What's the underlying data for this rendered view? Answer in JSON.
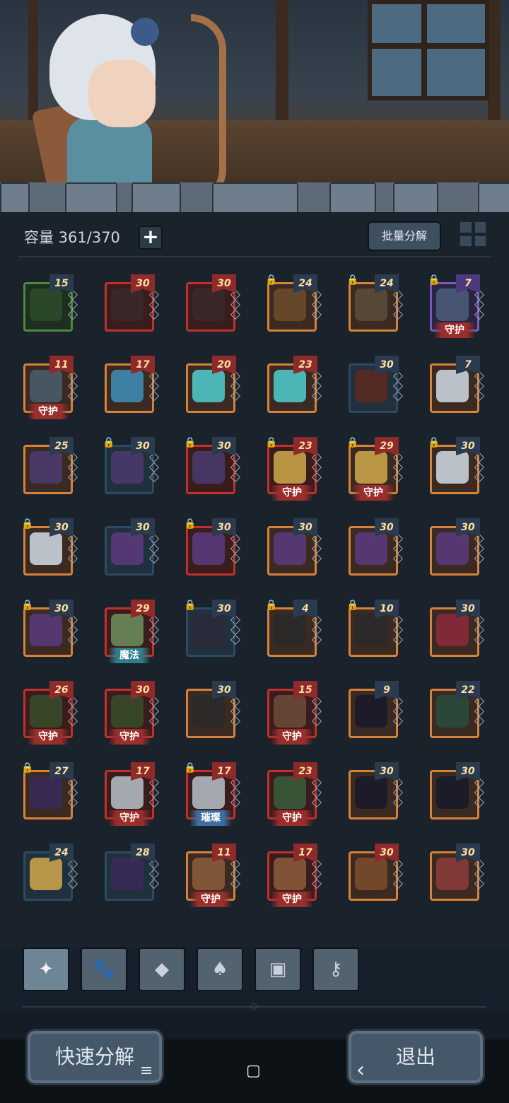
{
  "header": {
    "capacity_label": "容量 361/370",
    "plus_label": "+",
    "batch_label": "批量分解"
  },
  "items": [
    {
      "level": "15",
      "frame": "green",
      "lock": false,
      "tag": "",
      "tagType": "",
      "levelColor": "blue",
      "icon": "ring-icon",
      "color": "#2c4a2a"
    },
    {
      "level": "30",
      "frame": "red",
      "lock": false,
      "tag": "",
      "tagType": "",
      "levelColor": "red",
      "icon": "gauntlet-icon",
      "color": "#3a2a2a"
    },
    {
      "level": "30",
      "frame": "red",
      "lock": false,
      "tag": "",
      "tagType": "",
      "levelColor": "red",
      "icon": "gauntlet-icon",
      "color": "#3a2a2a"
    },
    {
      "level": "24",
      "frame": "orange",
      "lock": true,
      "tag": "",
      "tagType": "",
      "levelColor": "blue",
      "icon": "trident-icon",
      "color": "#6a4a2a"
    },
    {
      "level": "24",
      "frame": "orange",
      "lock": true,
      "tag": "",
      "tagType": "",
      "levelColor": "blue",
      "icon": "bow-icon",
      "color": "#5a4a3a"
    },
    {
      "level": "7",
      "frame": "purple",
      "lock": true,
      "tag": "守护",
      "tagType": "guard",
      "levelColor": "purple",
      "icon": "staff-icon",
      "color": "#4a5a7a"
    },
    {
      "level": "11",
      "frame": "orange",
      "lock": false,
      "tag": "守护",
      "tagType": "guard",
      "levelColor": "red",
      "icon": "staff-icon",
      "color": "#4a5a6a"
    },
    {
      "level": "17",
      "frame": "orange",
      "lock": false,
      "tag": "",
      "tagType": "",
      "levelColor": "red",
      "icon": "boomerang-icon",
      "color": "#3f8ab0"
    },
    {
      "level": "20",
      "frame": "orange",
      "lock": false,
      "tag": "",
      "tagType": "",
      "levelColor": "red",
      "icon": "crystal-sword-icon",
      "color": "#4ec5c5"
    },
    {
      "level": "23",
      "frame": "orange",
      "lock": false,
      "tag": "",
      "tagType": "",
      "levelColor": "red",
      "icon": "crystal-sword-icon",
      "color": "#4ec5c5"
    },
    {
      "level": "30",
      "frame": "blue",
      "lock": false,
      "tag": "",
      "tagType": "",
      "levelColor": "blue",
      "icon": "bow-icon",
      "color": "#5a2a22"
    },
    {
      "level": "7",
      "frame": "orange",
      "lock": false,
      "tag": "",
      "tagType": "",
      "levelColor": "blue",
      "icon": "hood-icon",
      "color": "#c9d2db"
    },
    {
      "level": "25",
      "frame": "orange",
      "lock": false,
      "tag": "",
      "tagType": "",
      "levelColor": "blue",
      "icon": "helmet-icon",
      "color": "#4a3a6a"
    },
    {
      "level": "30",
      "frame": "blue",
      "lock": true,
      "tag": "",
      "tagType": "",
      "levelColor": "blue",
      "icon": "helmet-icon",
      "color": "#4a3a6a"
    },
    {
      "level": "30",
      "frame": "red",
      "lock": true,
      "tag": "",
      "tagType": "",
      "levelColor": "blue",
      "icon": "helmet-icon",
      "color": "#4a3a6a"
    },
    {
      "level": "23",
      "frame": "red",
      "lock": true,
      "tag": "守护",
      "tagType": "guard",
      "levelColor": "red",
      "icon": "crown-icon",
      "color": "#c9a24a"
    },
    {
      "level": "29",
      "frame": "orange",
      "lock": true,
      "tag": "守护",
      "tagType": "guard",
      "levelColor": "red",
      "icon": "crown-icon",
      "color": "#c9a24a"
    },
    {
      "level": "30",
      "frame": "orange",
      "lock": true,
      "tag": "",
      "tagType": "",
      "levelColor": "blue",
      "icon": "hood-icon",
      "color": "#c9d2db"
    },
    {
      "level": "30",
      "frame": "orange",
      "lock": true,
      "tag": "",
      "tagType": "",
      "levelColor": "blue",
      "icon": "hood-icon",
      "color": "#c9d2db"
    },
    {
      "level": "30",
      "frame": "blue",
      "lock": false,
      "tag": "",
      "tagType": "",
      "levelColor": "blue",
      "icon": "robe-icon",
      "color": "#5a3a7a"
    },
    {
      "level": "30",
      "frame": "red",
      "lock": true,
      "tag": "",
      "tagType": "",
      "levelColor": "blue",
      "icon": "robe-icon",
      "color": "#5a3a7a"
    },
    {
      "level": "30",
      "frame": "orange",
      "lock": false,
      "tag": "",
      "tagType": "",
      "levelColor": "blue",
      "icon": "robe-icon",
      "color": "#5a3a7a"
    },
    {
      "level": "30",
      "frame": "orange",
      "lock": false,
      "tag": "",
      "tagType": "",
      "levelColor": "blue",
      "icon": "robe-icon",
      "color": "#5a3a7a"
    },
    {
      "level": "30",
      "frame": "orange",
      "lock": false,
      "tag": "",
      "tagType": "",
      "levelColor": "blue",
      "icon": "robe-icon",
      "color": "#5a3a7a"
    },
    {
      "level": "30",
      "frame": "orange",
      "lock": true,
      "tag": "",
      "tagType": "",
      "levelColor": "blue",
      "icon": "robe-icon",
      "color": "#5a3a7a"
    },
    {
      "level": "29",
      "frame": "red",
      "lock": false,
      "tag": "魔法",
      "tagType": "magic",
      "levelColor": "red",
      "icon": "tunic-icon",
      "color": "#6a8a5a"
    },
    {
      "level": "30",
      "frame": "blue",
      "lock": true,
      "tag": "",
      "tagType": "",
      "levelColor": "blue",
      "icon": "coat-icon",
      "color": "#2a2a3a"
    },
    {
      "level": "4",
      "frame": "orange",
      "lock": true,
      "tag": "",
      "tagType": "",
      "levelColor": "blue",
      "icon": "bracer-icon",
      "color": "#2a2a2a"
    },
    {
      "level": "10",
      "frame": "orange",
      "lock": true,
      "tag": "",
      "tagType": "",
      "levelColor": "blue",
      "icon": "bracer-icon",
      "color": "#2a2a2a"
    },
    {
      "level": "30",
      "frame": "orange",
      "lock": false,
      "tag": "",
      "tagType": "",
      "levelColor": "blue",
      "icon": "feather-icon",
      "color": "#8a2a3a"
    },
    {
      "level": "26",
      "frame": "red",
      "lock": false,
      "tag": "守护",
      "tagType": "guard",
      "levelColor": "red",
      "icon": "bracer-icon",
      "color": "#3a4a2a"
    },
    {
      "level": "30",
      "frame": "red",
      "lock": false,
      "tag": "守护",
      "tagType": "guard",
      "levelColor": "red",
      "icon": "bracer-icon",
      "color": "#3a4a2a"
    },
    {
      "level": "30",
      "frame": "orange",
      "lock": false,
      "tag": "",
      "tagType": "",
      "levelColor": "blue",
      "icon": "bracer-icon",
      "color": "#2a2a2a"
    },
    {
      "level": "15",
      "frame": "red",
      "lock": false,
      "tag": "守护",
      "tagType": "guard",
      "levelColor": "red",
      "icon": "bracer-icon",
      "color": "#6a4a3a"
    },
    {
      "level": "9",
      "frame": "orange",
      "lock": false,
      "tag": "",
      "tagType": "",
      "levelColor": "blue",
      "icon": "boots-icon",
      "color": "#1a1a2a"
    },
    {
      "level": "22",
      "frame": "orange",
      "lock": false,
      "tag": "",
      "tagType": "",
      "levelColor": "blue",
      "icon": "boots-icon",
      "color": "#2a4a3a"
    },
    {
      "level": "27",
      "frame": "orange",
      "lock": true,
      "tag": "",
      "tagType": "",
      "levelColor": "blue",
      "icon": "boots-icon",
      "color": "#3a2a5a"
    },
    {
      "level": "17",
      "frame": "red",
      "lock": false,
      "tag": "守护",
      "tagType": "guard",
      "levelColor": "red",
      "icon": "boots-icon",
      "color": "#b0b8c0"
    },
    {
      "level": "17",
      "frame": "red",
      "lock": true,
      "tag": "璀璨",
      "tagType": "cui",
      "levelColor": "red",
      "icon": "boots-icon",
      "color": "#b0b8c0"
    },
    {
      "level": "23",
      "frame": "red",
      "lock": false,
      "tag": "守护",
      "tagType": "guard",
      "levelColor": "red",
      "icon": "boots-icon",
      "color": "#3a5a3a"
    },
    {
      "level": "30",
      "frame": "orange",
      "lock": false,
      "tag": "",
      "tagType": "",
      "levelColor": "blue",
      "icon": "boots-icon",
      "color": "#1a1a2a"
    },
    {
      "level": "30",
      "frame": "orange",
      "lock": false,
      "tag": "",
      "tagType": "",
      "levelColor": "blue",
      "icon": "boots-icon",
      "color": "#1a1a2a"
    },
    {
      "level": "24",
      "frame": "blue",
      "lock": false,
      "tag": "",
      "tagType": "",
      "levelColor": "blue",
      "icon": "amulet-icon",
      "color": "#c9a24a"
    },
    {
      "level": "28",
      "frame": "blue",
      "lock": false,
      "tag": "",
      "tagType": "",
      "levelColor": "blue",
      "icon": "cloak-icon",
      "color": "#3a2a5a"
    },
    {
      "level": "11",
      "frame": "orange",
      "lock": false,
      "tag": "守护",
      "tagType": "guard",
      "levelColor": "red",
      "icon": "belt-icon",
      "color": "#8a5a3a"
    },
    {
      "level": "17",
      "frame": "red",
      "lock": false,
      "tag": "守护",
      "tagType": "guard",
      "levelColor": "red",
      "icon": "belt-icon",
      "color": "#8a5a3a"
    },
    {
      "level": "30",
      "frame": "orange",
      "lock": false,
      "tag": "",
      "tagType": "",
      "levelColor": "red",
      "icon": "belt-icon",
      "color": "#7a4a2a"
    },
    {
      "level": "30",
      "frame": "orange",
      "lock": false,
      "tag": "",
      "tagType": "",
      "levelColor": "blue",
      "icon": "ring-icon",
      "color": "#8a3a3a"
    }
  ],
  "tabs": [
    {
      "name": "weapon-tab",
      "glyph": "✦",
      "active": true
    },
    {
      "name": "pet-tab",
      "glyph": "🐾",
      "active": false
    },
    {
      "name": "gem-tab",
      "glyph": "◆",
      "active": false
    },
    {
      "name": "material-tab",
      "glyph": "♠",
      "active": false
    },
    {
      "name": "chest-tab",
      "glyph": "▣",
      "active": false
    },
    {
      "name": "key-tab",
      "glyph": "⚷",
      "active": false
    }
  ],
  "footer": {
    "quick_decompose": "快速分解",
    "exit": "退出"
  },
  "system_nav": {
    "menu": "≡",
    "home": "▢",
    "back": "‹"
  }
}
